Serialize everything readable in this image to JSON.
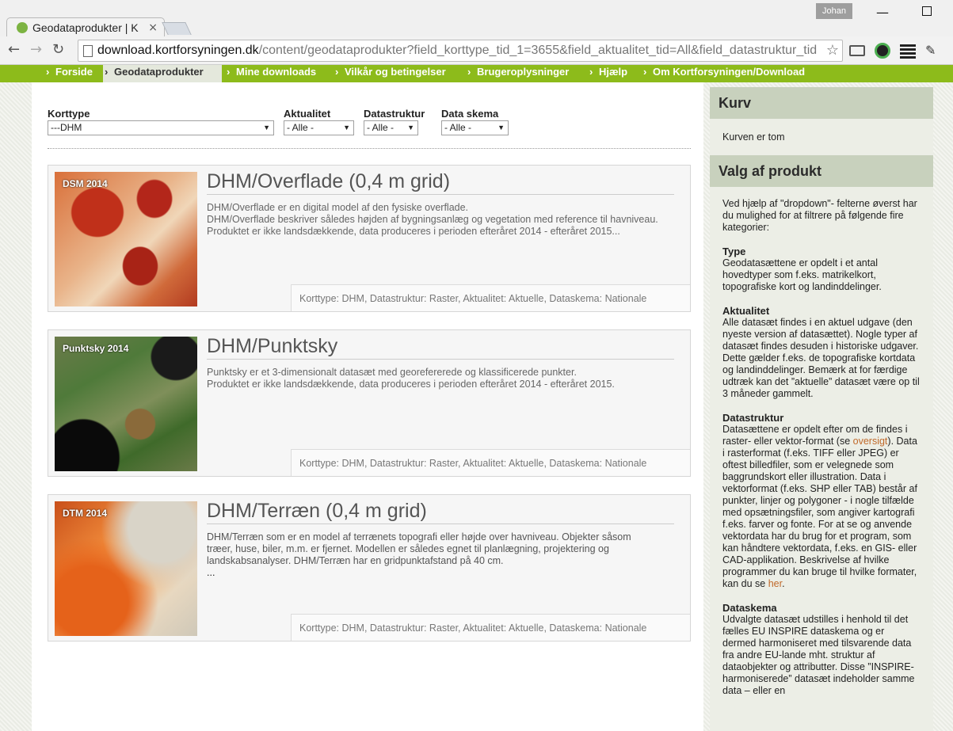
{
  "browser": {
    "tab_title": "Geodataprodukter | K",
    "url_host": "download.kortforsyningen.dk",
    "url_path": "/content/geodataprodukter?field_korttype_tid_1=3655&field_aktualitet_tid=All&field_datastruktur_tid",
    "user": "Johan"
  },
  "nav": {
    "items": [
      "Forside",
      "Geodataprodukter",
      "Mine downloads",
      "Vilkår og betingelser",
      "Brugeroplysninger",
      "Hjælp",
      "Om Kortforsyningen/Download"
    ],
    "active_index": 1
  },
  "filters": {
    "korttype": {
      "label": "Korttype",
      "value": "---DHM"
    },
    "aktualitet": {
      "label": "Aktualitet",
      "value": "- Alle -"
    },
    "datastruktur": {
      "label": "Datastruktur",
      "value": "- Alle -"
    },
    "dataskema": {
      "label": "Data skema",
      "value": "- Alle -"
    }
  },
  "products": [
    {
      "thumb_label": "DSM 2014",
      "title": "DHM/Overflade (0,4 m grid)",
      "desc_lines": [
        "DHM/Overflade er en digital model af den fysiske overflade.",
        "DHM/Overflade beskriver således højden af bygningsanlæg og vegetation med reference til havniveau.",
        "Produktet er ikke landsdækkende, data produceres i perioden efteråret 2014 - efteråret 2015..."
      ],
      "meta": "Korttype: DHM, Datastruktur: Raster, Aktualitet: Aktuelle, Dataskema: Nationale"
    },
    {
      "thumb_label": "Punktsky 2014",
      "title": "DHM/Punktsky",
      "desc_lines": [
        "Punktsky er et 3-dimensionalt datasæt med georefererede og klassificerede punkter.",
        "Produktet er ikke landsdækkende, data produceres i perioden efteråret 2014 - efteråret 2015.",
        ""
      ],
      "meta": "Korttype: DHM, Datastruktur: Raster, Aktualitet: Aktuelle, Dataskema: Nationale"
    },
    {
      "thumb_label": "DTM 2014",
      "title": "DHM/Terræn (0,4 m grid)",
      "desc_lines": [
        "DHM/Terræn som er en model af terrænets topografi eller højde over havniveau. Objekter såsom",
        "træer, huse, biler, m.m. er fjernet. Modellen er således egnet til planlægning, projektering og",
        "landskabsanalyser. DHM/Terræn har en gridpunktafstand på 40 cm.",
        "..."
      ],
      "meta": "Korttype: DHM, Datastruktur: Raster, Aktualitet: Aktuelle, Dataskema: Nationale"
    }
  ],
  "sidebar": {
    "cart_title": "Kurv",
    "cart_text": "Kurven er tom",
    "help_title": "Valg af produkt",
    "intro": "Ved hjælp af \"dropdown\"- felterne øverst har du mulighed for at filtrere på følgende fire kategorier:",
    "type_head": "Type",
    "type_text": "Geodatasættene er opdelt i et antal hovedtyper som f.eks. matrikelkort, topografiske kort og landinddelinger.",
    "akt_head": "Aktualitet",
    "akt_text": "Alle datasæt findes i en aktuel udgave (den nyeste version af datasættet). Nogle typer af datasæt findes desuden i historiske udgaver. Dette gælder f.eks. de topografiske kortdata og landinddelinger. Bemærk at for færdige udtræk kan det ”aktuelle” datasæt være op til 3 måneder gammelt.",
    "ds_head": "Datastruktur",
    "ds_text_1": "Datasættene er opdelt efter om de findes i raster- eller vektor-format (se ",
    "ds_link_1": "oversigt",
    "ds_text_2": "). Data i rasterformat (f.eks. TIFF eller JPEG) er oftest billedfiler, som er velegnede som baggrundskort eller illustration. Data i vektorformat (f.eks. SHP eller TAB) består af punkter, linjer og polygoner - i nogle tilfælde med opsætningsfiler, som angiver kartografi f.eks. farver og fonte. For at se og anvende vektordata har du brug for et program, som kan håndtere vektordata, f.eks. en GIS- eller CAD-applikation. Beskrivelse af hvilke programmer du kan bruge til hvilke formater, kan du se ",
    "ds_link_2": "her",
    "ds_text_3": ".",
    "sk_head": "Dataskema",
    "sk_text": "Udvalgte datasæt udstilles i henhold til det fælles EU INSPIRE dataskema og er dermed harmoniseret med tilsvarende data fra andre EU-lande mht. struktur af dataobjekter og attributter. Disse ”INSPIRE-harmoniserede” datasæt indeholder samme data – eller en"
  },
  "colors": {
    "nav_green": "#8dbb1b",
    "sidebar_head": "#c8d1bd",
    "link": "#c0692a"
  }
}
